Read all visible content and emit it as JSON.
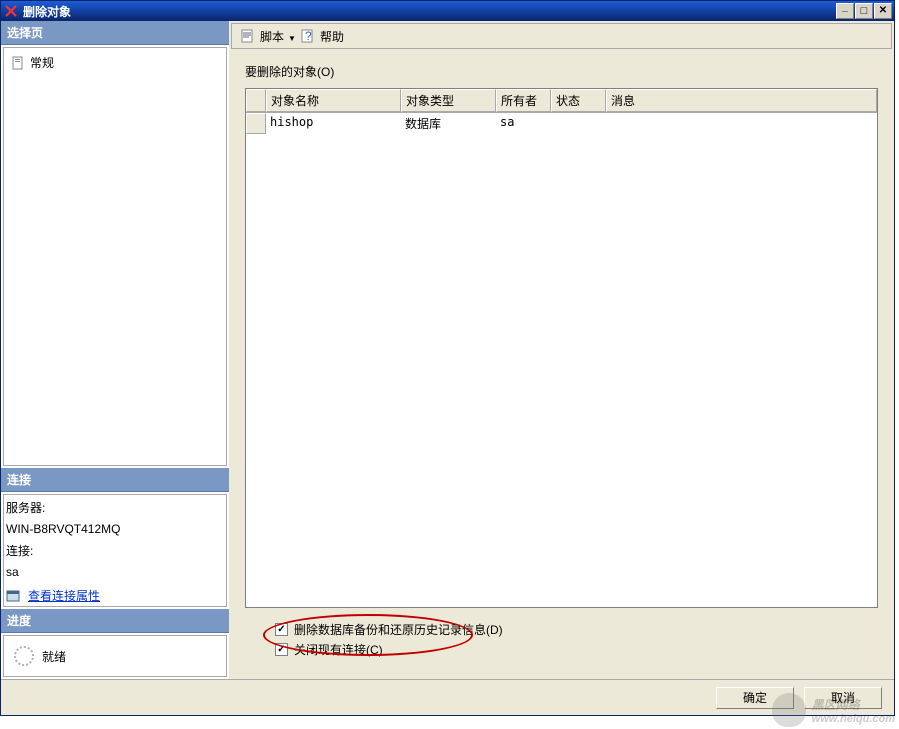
{
  "title": "删除对象",
  "sidebar": {
    "select_page": "选择页",
    "tree_item": "常规",
    "connection_header": "连接",
    "server_label": "服务器:",
    "server_value": "WIN-B8RVQT412MQ",
    "connection_label": "连接:",
    "connection_value": "sa",
    "view_props": "查看连接属性",
    "progress_header": "进度",
    "progress_status": "就绪"
  },
  "toolbar": {
    "script": "脚本",
    "help": "帮助"
  },
  "main": {
    "objects_to_delete": "要删除的对象(O)",
    "columns": {
      "name": "对象名称",
      "type": "对象类型",
      "owner": "所有者",
      "status": "状态",
      "message": "消息"
    },
    "rows": [
      {
        "name": "hishop",
        "type": "数据库",
        "owner": "sa",
        "status": "",
        "message": ""
      }
    ],
    "check1": "删除数据库备份和还原历史记录信息(D)",
    "check2": "关闭现有连接(C)"
  },
  "buttons": {
    "ok": "确定",
    "cancel": "取消"
  },
  "watermark": {
    "main": "黑区网络",
    "sub": "www.heiqu.com"
  }
}
